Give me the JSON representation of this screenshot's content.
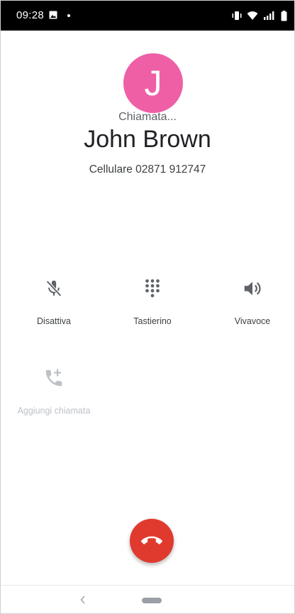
{
  "status_bar": {
    "time": "09:28",
    "icons": [
      "photo-icon",
      "dot",
      "vibrate-icon",
      "wifi-icon",
      "cell-signal-icon",
      "battery-icon"
    ]
  },
  "caller": {
    "avatar_initial": "J",
    "avatar_color": "#ee5fa6",
    "status": "Chiamata...",
    "name": "John Brown",
    "number_line": "Cellulare 02871 912747"
  },
  "actions": [
    {
      "id": "mute",
      "label": "Disattiva",
      "icon": "mic-off-icon",
      "enabled": true
    },
    {
      "id": "keypad",
      "label": "Tastierino",
      "icon": "dialpad-icon",
      "enabled": true
    },
    {
      "id": "speaker",
      "label": "Vivavoce",
      "icon": "speaker-icon",
      "enabled": true
    },
    {
      "id": "add_call",
      "label": "Aggiungi chiamata",
      "icon": "add-call-icon",
      "enabled": false
    }
  ],
  "end_call": {
    "icon": "call-end-icon",
    "color": "#e03a2f"
  },
  "nav": {
    "icons": [
      "back-icon",
      "home-pill"
    ]
  }
}
